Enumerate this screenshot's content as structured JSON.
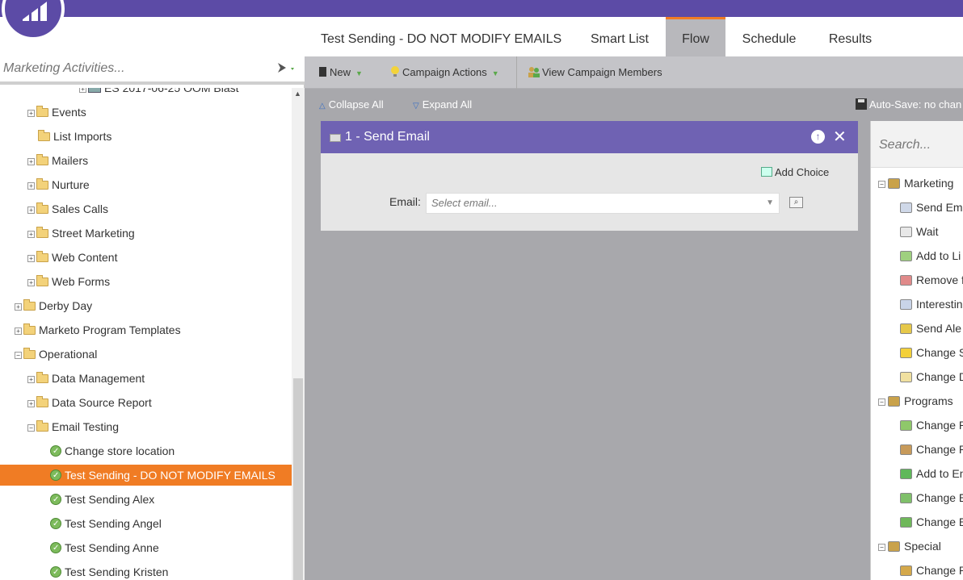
{
  "sidebar": {
    "filter_placeholder": "Marketing Activities...",
    "tree": [
      {
        "label": "ES 2017-06-25 OOM Blast",
        "type": "email-program",
        "expand": "+",
        "indent": 1
      },
      {
        "label": "Events",
        "type": "folder",
        "expand": "+",
        "indent": 2
      },
      {
        "label": "List Imports",
        "type": "folder",
        "expand": "",
        "indent": 2
      },
      {
        "label": "Mailers",
        "type": "folder",
        "expand": "+",
        "indent": 2
      },
      {
        "label": "Nurture",
        "type": "folder",
        "expand": "+",
        "indent": 2
      },
      {
        "label": "Sales Calls",
        "type": "folder",
        "expand": "+",
        "indent": 2
      },
      {
        "label": "Street Marketing",
        "type": "folder",
        "expand": "+",
        "indent": 2
      },
      {
        "label": "Web Content",
        "type": "folder",
        "expand": "+",
        "indent": 2
      },
      {
        "label": "Web Forms",
        "type": "folder",
        "expand": "+",
        "indent": 2
      },
      {
        "label": "Derby Day",
        "type": "folder",
        "expand": "+",
        "indent": 1
      },
      {
        "label": "Marketo Program Templates",
        "type": "folder",
        "expand": "+",
        "indent": 1
      },
      {
        "label": "Operational",
        "type": "folder",
        "expand": "−",
        "indent": 1
      },
      {
        "label": "Data Management",
        "type": "folder",
        "expand": "+",
        "indent": 2
      },
      {
        "label": "Data Source Report",
        "type": "folder",
        "expand": "+",
        "indent": 2
      },
      {
        "label": "Email Testing",
        "type": "folder",
        "expand": "−",
        "indent": 2
      },
      {
        "label": "Change store location",
        "type": "campaign",
        "expand": "",
        "indent": 3
      },
      {
        "label": "Test Sending - DO NOT MODIFY EMAILS",
        "type": "campaign",
        "expand": "",
        "indent": 3,
        "selected": true
      },
      {
        "label": "Test Sending Alex",
        "type": "campaign",
        "expand": "",
        "indent": 3
      },
      {
        "label": "Test Sending Angel",
        "type": "campaign",
        "expand": "",
        "indent": 3
      },
      {
        "label": "Test Sending Anne",
        "type": "campaign",
        "expand": "",
        "indent": 3
      },
      {
        "label": "Test Sending Kristen",
        "type": "campaign",
        "expand": "",
        "indent": 3
      }
    ]
  },
  "tabs": {
    "title": "Test Sending - DO NOT MODIFY EMAILS",
    "smart_list": "Smart List",
    "flow": "Flow",
    "schedule": "Schedule",
    "results": "Results"
  },
  "toolbar": {
    "new_label": "New",
    "campaign_actions_label": "Campaign Actions",
    "view_members_label": "View Campaign Members"
  },
  "subbar": {
    "collapse_all": "Collapse All",
    "expand_all": "Expand All",
    "autosave": "Auto-Save: no chan"
  },
  "step": {
    "title": "1 - Send Email",
    "add_choice": "Add Choice",
    "email_label": "Email:",
    "email_placeholder": "Select email..."
  },
  "palette": {
    "search_placeholder": "Search...",
    "items": [
      {
        "label": "Marketing",
        "group": true
      },
      {
        "label": "Send Em",
        "color": "#cfd8e8"
      },
      {
        "label": "Wait",
        "color": "#e8e8e8"
      },
      {
        "label": "Add to Li",
        "color": "#9fd07f"
      },
      {
        "label": "Remove f",
        "color": "#e08a8a"
      },
      {
        "label": "Interestin",
        "color": "#c9d4e8"
      },
      {
        "label": "Send Ale",
        "color": "#e6c84a"
      },
      {
        "label": "Change S",
        "color": "#f3d03a"
      },
      {
        "label": "Change D",
        "color": "#f0e0a0"
      },
      {
        "label": "Programs",
        "group": true
      },
      {
        "label": "Change P",
        "color": "#8fc86a"
      },
      {
        "label": "Change P",
        "color": "#c79a5a"
      },
      {
        "label": "Add to En",
        "color": "#5fb85a"
      },
      {
        "label": "Change E",
        "color": "#7fc06a"
      },
      {
        "label": "Change E",
        "color": "#6fb85a"
      },
      {
        "label": "Special",
        "group": true
      },
      {
        "label": "Change P",
        "color": "#d4a84a"
      }
    ]
  },
  "colors": {
    "brand": "#5c4ba6",
    "accent": "#f07c24",
    "step_header": "#6f62b3"
  }
}
